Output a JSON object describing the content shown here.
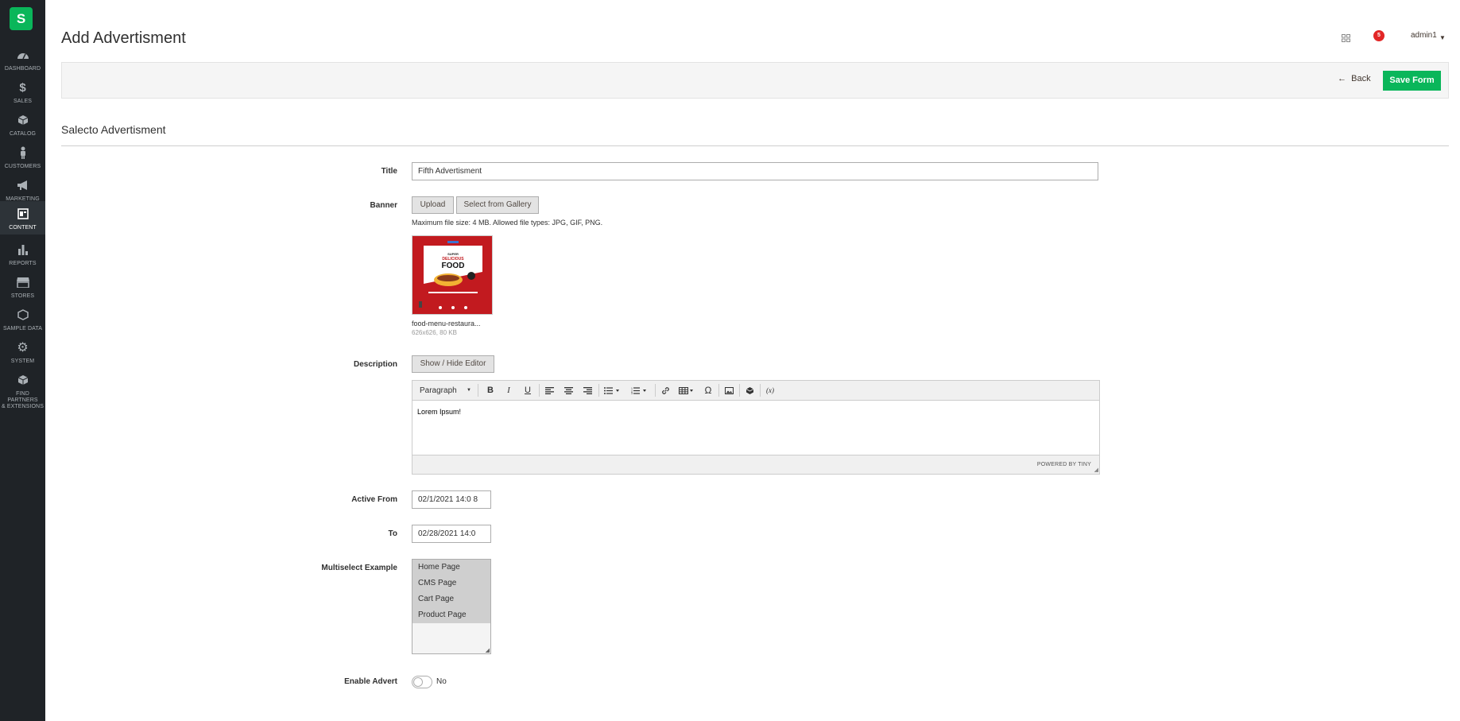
{
  "sidebar": {
    "logo": "S",
    "items": [
      {
        "label": "DASHBOARD",
        "icon": "dashboard-icon"
      },
      {
        "label": "SALES",
        "icon": "dollar-icon"
      },
      {
        "label": "CATALOG",
        "icon": "cube-icon"
      },
      {
        "label": "CUSTOMERS",
        "icon": "person-icon"
      },
      {
        "label": "MARKETING",
        "icon": "megaphone-icon"
      },
      {
        "label": "CONTENT",
        "icon": "content-icon",
        "active": true
      },
      {
        "label": "REPORTS",
        "icon": "bar-chart-icon"
      },
      {
        "label": "STORES",
        "icon": "store-icon"
      },
      {
        "label": "SAMPLE DATA",
        "icon": "hexagon-icon"
      },
      {
        "label": "SYSTEM",
        "icon": "gear-icon"
      },
      {
        "label_line1": "FIND PARTNERS",
        "label_line2": "& EXTENSIONS",
        "icon": "box-icon"
      }
    ]
  },
  "header": {
    "title": "Add Advertisment",
    "notifications_count": "5",
    "user": "admin1"
  },
  "actions": {
    "back_label": "Back",
    "save_label": "Save Form"
  },
  "section": {
    "title": "Salecto Advertisment"
  },
  "form": {
    "title_label": "Title",
    "title_value": "Fifth Advertisment",
    "banner_label": "Banner",
    "upload_label": "Upload",
    "gallery_label": "Select from Gallery",
    "file_note": "Maximum file size: 4 MB. Allowed file types: JPG, GIF, PNG.",
    "file_name": "food-menu-restaura...",
    "file_meta": "626x626, 80 KB",
    "thumb_text_top": "SUPER",
    "thumb_text_mid": "DELICIOUS",
    "thumb_text_main": "FOOD",
    "description_label": "Description",
    "show_hide_label": "Show / Hide Editor",
    "editor": {
      "format_select": "Paragraph",
      "content": "Lorem Ipsum!",
      "powered_by": "POWERED BY TINY"
    },
    "active_from_label": "Active From",
    "active_from_value": "02/1/2021 14:0 8",
    "to_label": "To",
    "to_value": "02/28/2021 14:0",
    "multiselect_label": "Multiselect Example",
    "multiselect_options": [
      "Home Page",
      "CMS Page",
      "Cart Page",
      "Product Page"
    ],
    "enable_label": "Enable Advert",
    "enable_value": "No"
  },
  "colors": {
    "sidebar_bg": "#1f2327",
    "accent_green": "#0ab65a",
    "thumb_red": "#c21a1f",
    "notification_red": "#e22626"
  }
}
